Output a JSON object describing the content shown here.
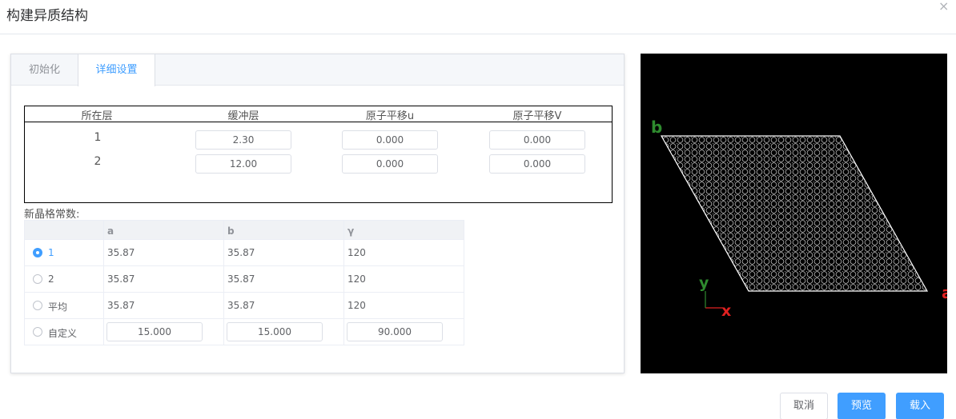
{
  "dialog": {
    "title": "构建异质结构",
    "close_glyph": "×"
  },
  "tabs": [
    {
      "label": "初始化",
      "active": false
    },
    {
      "label": "详细设置",
      "active": true
    }
  ],
  "layers": {
    "headers": [
      "所在层",
      "缓冲层",
      "原子平移u",
      "原子平移V"
    ],
    "rows": [
      {
        "layer": "1",
        "buffer": "2.30",
        "shift_u": "0.000",
        "shift_v": "0.000"
      },
      {
        "layer": "2",
        "buffer": "12.00",
        "shift_u": "0.000",
        "shift_v": "0.000"
      }
    ]
  },
  "lattice": {
    "label": "新晶格常数:",
    "headers": [
      "a",
      "b",
      "γ"
    ],
    "rows": [
      {
        "label": "1",
        "selected": true,
        "a": "35.87",
        "b": "35.87",
        "gamma": "120"
      },
      {
        "label": "2",
        "selected": false,
        "a": "35.87",
        "b": "35.87",
        "gamma": "120"
      },
      {
        "label": "平均",
        "selected": false,
        "a": "35.87",
        "b": "35.87",
        "gamma": "120"
      },
      {
        "label": "自定义",
        "selected": false,
        "a": "15.000",
        "b": "15.000",
        "gamma": "90.000"
      }
    ]
  },
  "viewer": {
    "axis_b": "b",
    "axis_a": "a",
    "axis_y": "y",
    "axis_x": "x",
    "colors": {
      "background": "#000000",
      "b_axis": "#2e8b2e",
      "a_axis": "#e02020",
      "y_axis": "#2e8b2e",
      "x_axis": "#e02020",
      "atoms": "#bfbfbf"
    }
  },
  "buttons": {
    "cancel": "取消",
    "preview": "预览",
    "load": "载入"
  },
  "colors": {
    "accent": "#409eff"
  }
}
